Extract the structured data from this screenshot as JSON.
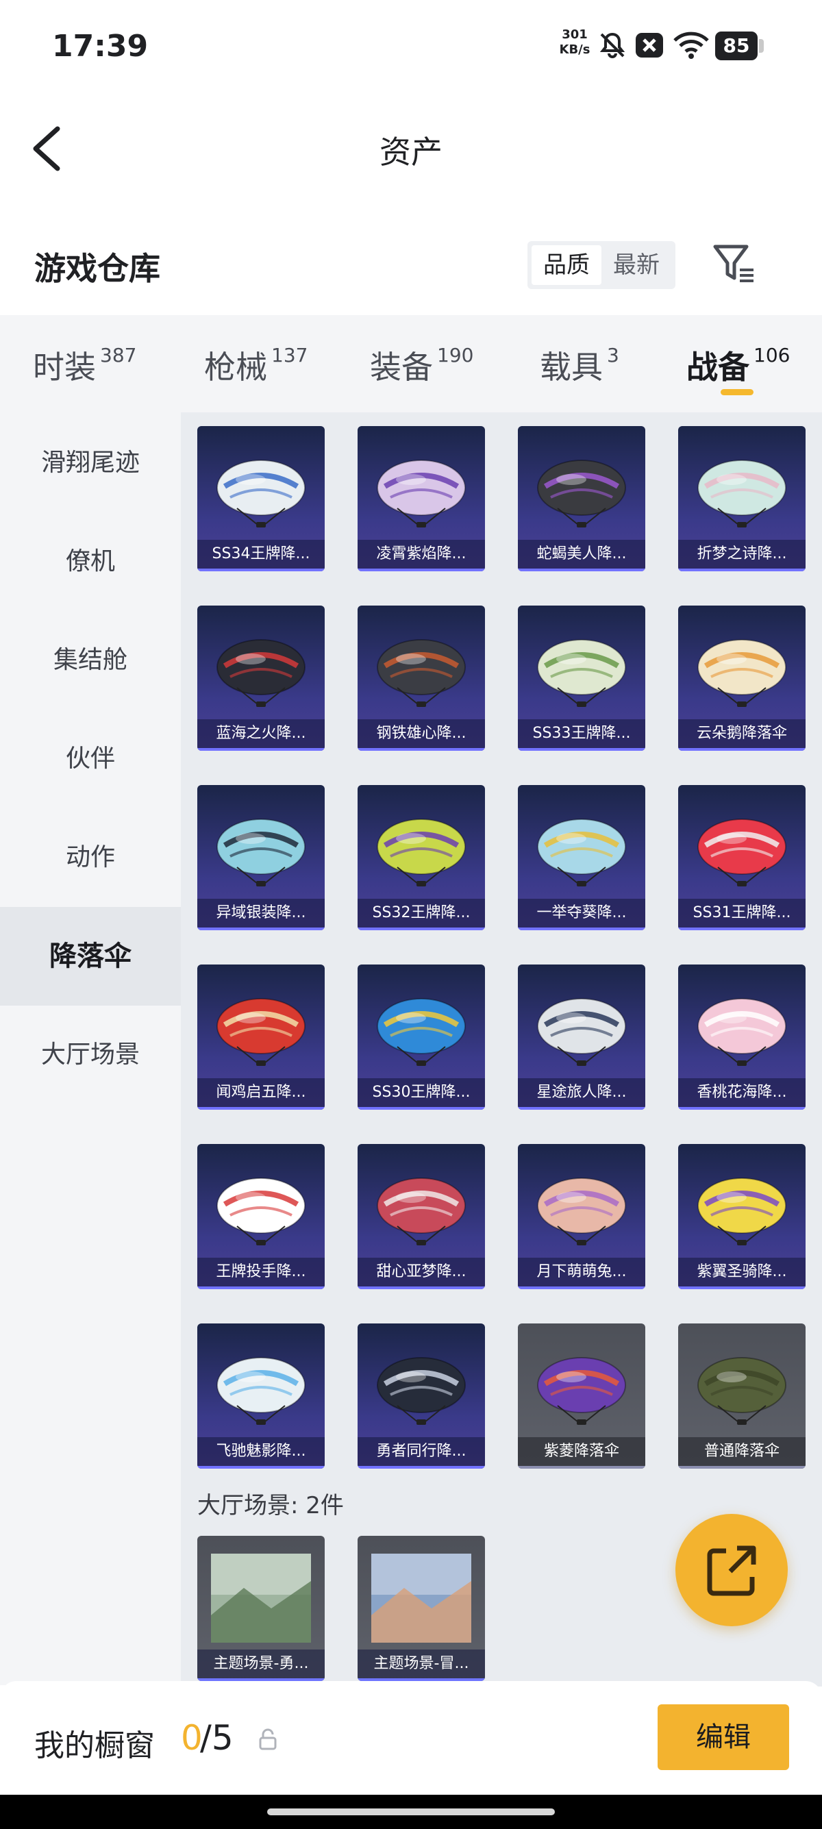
{
  "status_bar": {
    "time": "17:39",
    "speed_value": "301",
    "speed_unit": "KB/s",
    "battery": "85",
    "icons": [
      "bell-off-icon",
      "close-box-icon",
      "wifi-icon",
      "battery-icon"
    ]
  },
  "header": {
    "title": "资产",
    "back_icon": "chevron-left-icon"
  },
  "warehouse": {
    "title": "游戏仓库",
    "sort_options": [
      "品质",
      "最新"
    ],
    "active_sort": "品质",
    "filter_icon": "filter-icon"
  },
  "tabs": [
    {
      "label": "时装",
      "count": "387"
    },
    {
      "label": "枪械",
      "count": "137"
    },
    {
      "label": "装备",
      "count": "190"
    },
    {
      "label": "载具",
      "count": "3"
    },
    {
      "label": "战备",
      "count": "106"
    }
  ],
  "active_tab": "战备",
  "sidebar": {
    "items": [
      "滑翔尾迹",
      "僚机",
      "集结舱",
      "伙伴",
      "动作",
      "降落伞",
      "大厅场景"
    ],
    "active": "降落伞"
  },
  "parachutes": [
    {
      "name": "SS34王牌降...",
      "color": "#e8eef2",
      "accent": "#3a6cc8"
    },
    {
      "name": "凌霄紫焰降...",
      "color": "#d9c6e8",
      "accent": "#6a3fb0"
    },
    {
      "name": "蛇蝎美人降...",
      "color": "#3a3b40",
      "accent": "#9b59d0"
    },
    {
      "name": "折梦之诗降...",
      "color": "#cfe8e2",
      "accent": "#e8b8c8"
    },
    {
      "name": "蓝海之火降...",
      "color": "#2a2c36",
      "accent": "#d23a3a"
    },
    {
      "name": "钢铁雄心降...",
      "color": "#3b3d44",
      "accent": "#c85a30"
    },
    {
      "name": "SS33王牌降...",
      "color": "#dfe8d0",
      "accent": "#6a9a4a"
    },
    {
      "name": "云朵鹅降落伞",
      "color": "#f2e6c8",
      "accent": "#e89a3a"
    },
    {
      "name": "异域银装降...",
      "color": "#8fd0e0",
      "accent": "#202a3a"
    },
    {
      "name": "SS32王牌降...",
      "color": "#c8d84a",
      "accent": "#6a3fb0"
    },
    {
      "name": "一举夺葵降...",
      "color": "#a8d8e8",
      "accent": "#e8c03a"
    },
    {
      "name": "SS31王牌降...",
      "color": "#e83a4a",
      "accent": "#f0f0f0"
    },
    {
      "name": "闻鸡启五降...",
      "color": "#d83a30",
      "accent": "#f2dfa8"
    },
    {
      "name": "SS30王牌降...",
      "color": "#2f8ad8",
      "accent": "#f0c83a"
    },
    {
      "name": "星途旅人降...",
      "color": "#e0e4e8",
      "accent": "#2a3a5a"
    },
    {
      "name": "香桃花海降...",
      "color": "#f4c8d8",
      "accent": "#ffffff"
    },
    {
      "name": "王牌投手降...",
      "color": "#ffffff",
      "accent": "#d83a3a"
    },
    {
      "name": "甜心亚梦降...",
      "color": "#c84a5a",
      "accent": "#f0e8e8"
    },
    {
      "name": "月下萌萌兔...",
      "color": "#e8b8a8",
      "accent": "#a86ac8"
    },
    {
      "name": "紫翼圣骑降...",
      "color": "#f0d848",
      "accent": "#7a4ac8"
    },
    {
      "name": "飞驰魅影降...",
      "color": "#e8f0f4",
      "accent": "#5ab0e8"
    },
    {
      "name": "勇者同行降...",
      "color": "#262c3a",
      "accent": "#c8d0e0"
    },
    {
      "name": "紫菱降落伞",
      "color": "#6a3fb0",
      "accent": "#e85a3a",
      "grey": true
    },
    {
      "name": "普通降落伞",
      "color": "#55603a",
      "accent": "#3e4628",
      "grey": true
    }
  ],
  "scene_section": {
    "title": "大厅场景: 2件",
    "items": [
      {
        "name": "主题场景-勇...",
        "color": "#9fb5a0",
        "accent": "#5c7a58"
      },
      {
        "name": "主题场景-冒...",
        "color": "#8aa4c8",
        "accent": "#d8a078"
      }
    ]
  },
  "fab_icon": "external-link-icon",
  "showcase": {
    "label": "我的橱窗",
    "count": "0",
    "total": "/5",
    "lock_icon": "lock-icon"
  },
  "edit_button": "编辑"
}
